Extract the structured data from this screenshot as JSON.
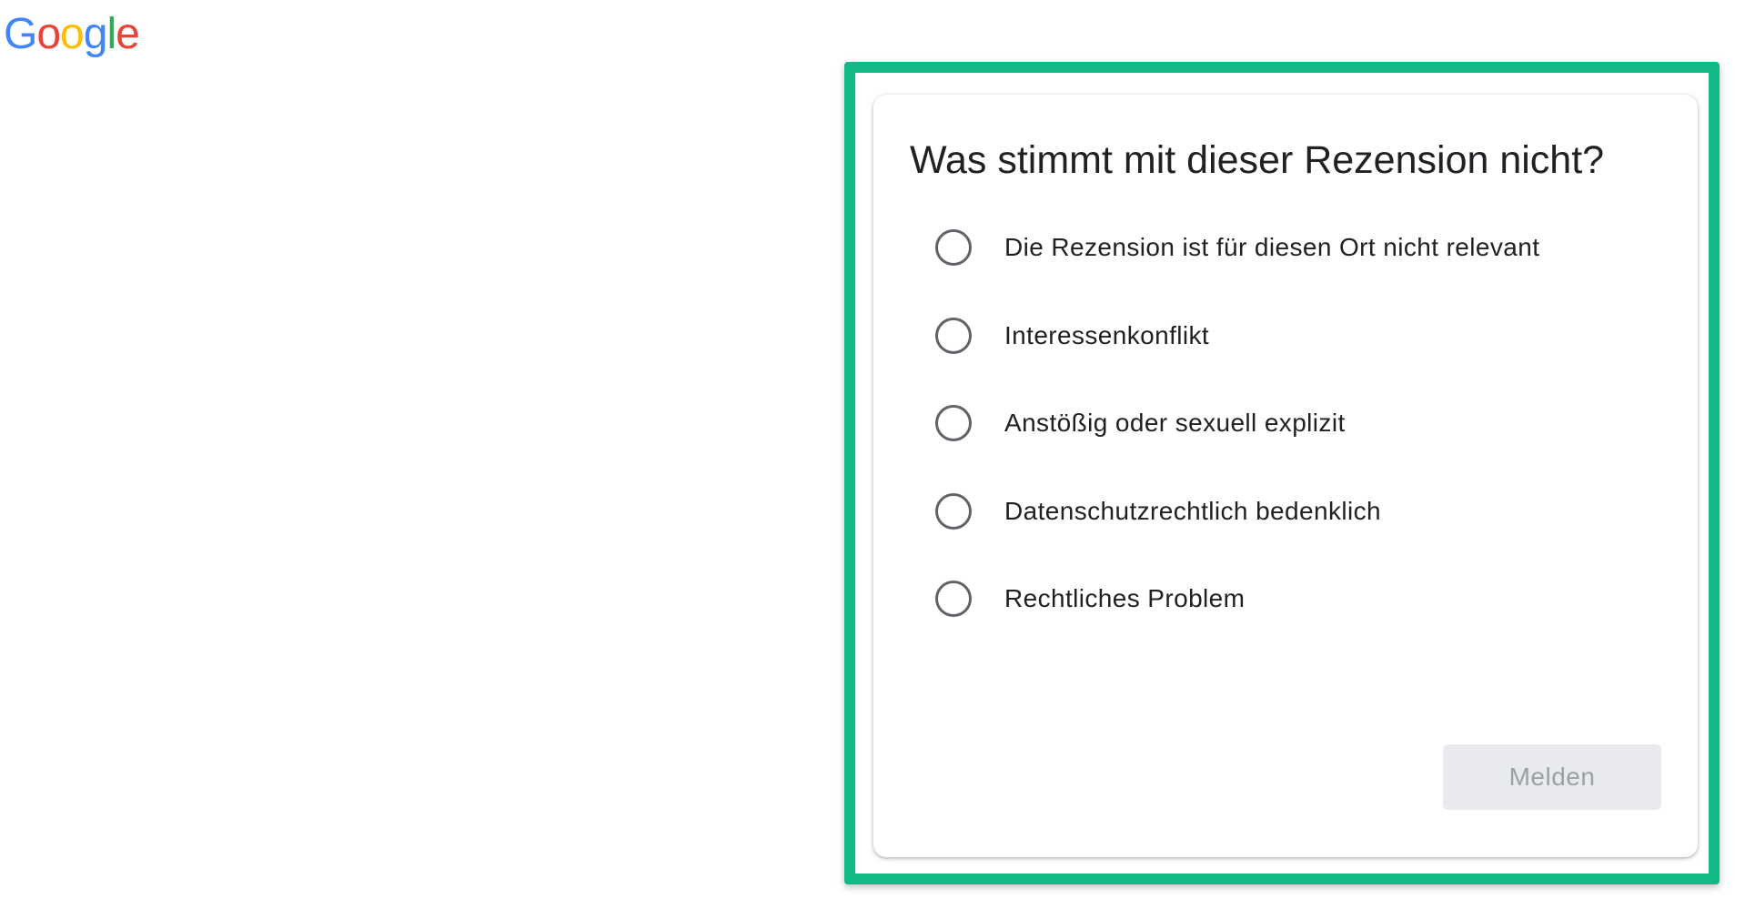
{
  "logo": {
    "letters": [
      {
        "char": "G",
        "color": "#4285F4"
      },
      {
        "char": "o",
        "color": "#EA4335"
      },
      {
        "char": "o",
        "color": "#FBBC05"
      },
      {
        "char": "g",
        "color": "#4285F4"
      },
      {
        "char": "l",
        "color": "#34A853"
      },
      {
        "char": "e",
        "color": "#EA4335"
      }
    ]
  },
  "dialog": {
    "title": "Was stimmt mit dieser Rezension nicht?",
    "options": [
      {
        "label": "Die Rezension ist für diesen Ort nicht relevant",
        "selected": false
      },
      {
        "label": "Interessenkonflikt",
        "selected": false
      },
      {
        "label": "Anstößig oder sexuell explizit",
        "selected": false
      },
      {
        "label": "Datenschutzrechtlich bedenklich",
        "selected": false
      },
      {
        "label": "Rechtliches Problem",
        "selected": false
      }
    ],
    "submit_label": "Melden",
    "submit_enabled": false
  },
  "colors": {
    "highlight_border": "#12b886",
    "radio_outline": "#5f6368",
    "button_disabled_bg": "#e8eaed",
    "button_disabled_text": "#9aa0a6"
  }
}
